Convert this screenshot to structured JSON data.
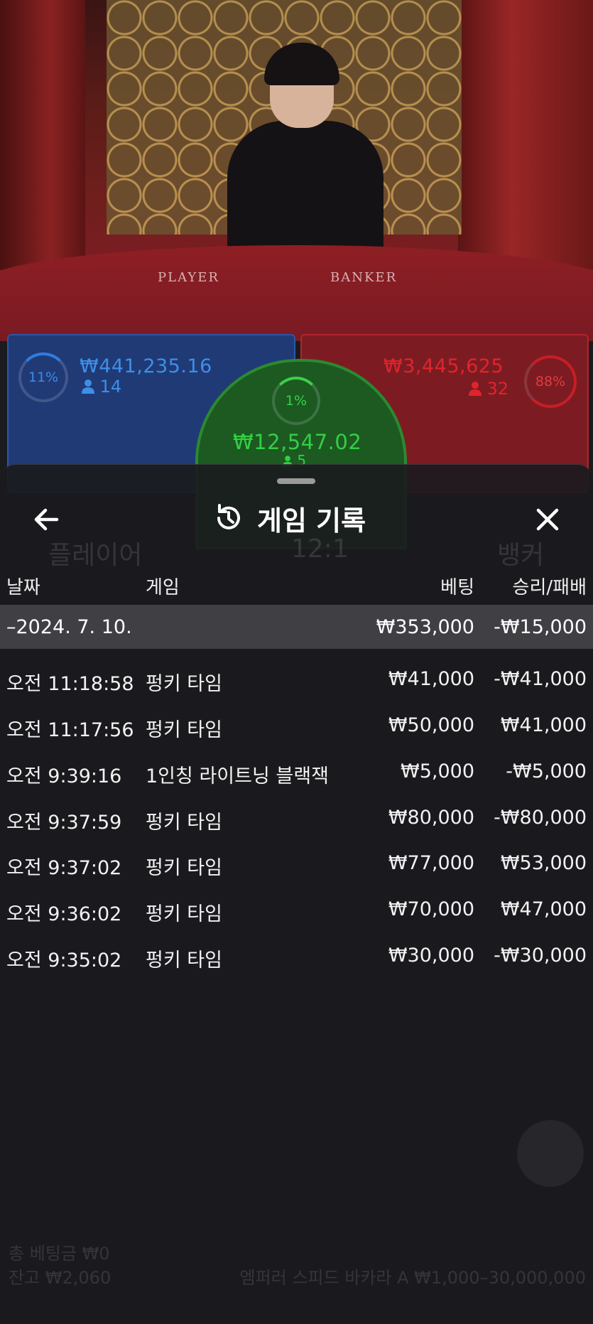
{
  "video": {
    "table_labels": [
      "PLAYER",
      "BANKER"
    ]
  },
  "bet_panels": {
    "player": {
      "percent": "11%",
      "amount": "₩441,235.16",
      "players": "14"
    },
    "banker": {
      "percent": "88%",
      "amount": "₩3,445,625",
      "players": "32"
    },
    "tie": {
      "percent": "1%",
      "amount": "₩12,547.02",
      "players": "5"
    }
  },
  "sheet": {
    "title": "게임 기록",
    "columns": {
      "date": "날짜",
      "game": "게임",
      "bet": "베팅",
      "result": "승리/패배"
    },
    "date_group": {
      "date": "–2024. 7. 10.",
      "bet_total": "₩353,000",
      "result_total": "-₩15,000"
    },
    "rows": [
      {
        "time": "오전 11:18:58",
        "game": "펑키 타임",
        "bet": "₩41,000",
        "result": "-₩41,000"
      },
      {
        "time": "오전 11:17:56",
        "game": "펑키 타임",
        "bet": "₩50,000",
        "result": "₩41,000"
      },
      {
        "time": "오전 9:39:16",
        "game": "1인칭 라이트닝 블랙잭",
        "bet": "₩5,000",
        "result": "-₩5,000"
      },
      {
        "time": "오전 9:37:59",
        "game": "펑키 타임",
        "bet": "₩80,000",
        "result": "-₩80,000"
      },
      {
        "time": "오전 9:37:02",
        "game": "펑키 타임",
        "bet": "₩77,000",
        "result": "₩53,000"
      },
      {
        "time": "오전 9:36:02",
        "game": "펑키 타임",
        "bet": "₩70,000",
        "result": "₩47,000"
      },
      {
        "time": "오전 9:35:02",
        "game": "펑키 타임",
        "bet": "₩30,000",
        "result": "-₩30,000"
      }
    ]
  },
  "background_text": {
    "player_label": "플레이어",
    "tie_odds": "12:1",
    "banker_label": "뱅커",
    "total_bet": "총 베팅금 ₩0",
    "balance": "잔고 ₩2,060",
    "table_info": "엠퍼러 스피드 바카라 A ₩1,000–30,000,000"
  },
  "icons": [
    "back-arrow-icon",
    "history-icon",
    "close-icon",
    "person-icon",
    "menu-icon"
  ],
  "colors": {
    "player": "#3d8fe8",
    "banker": "#e0242c",
    "tie": "#33cf43",
    "sheet_bg": "#1e1e20",
    "date_row": "#404044"
  }
}
